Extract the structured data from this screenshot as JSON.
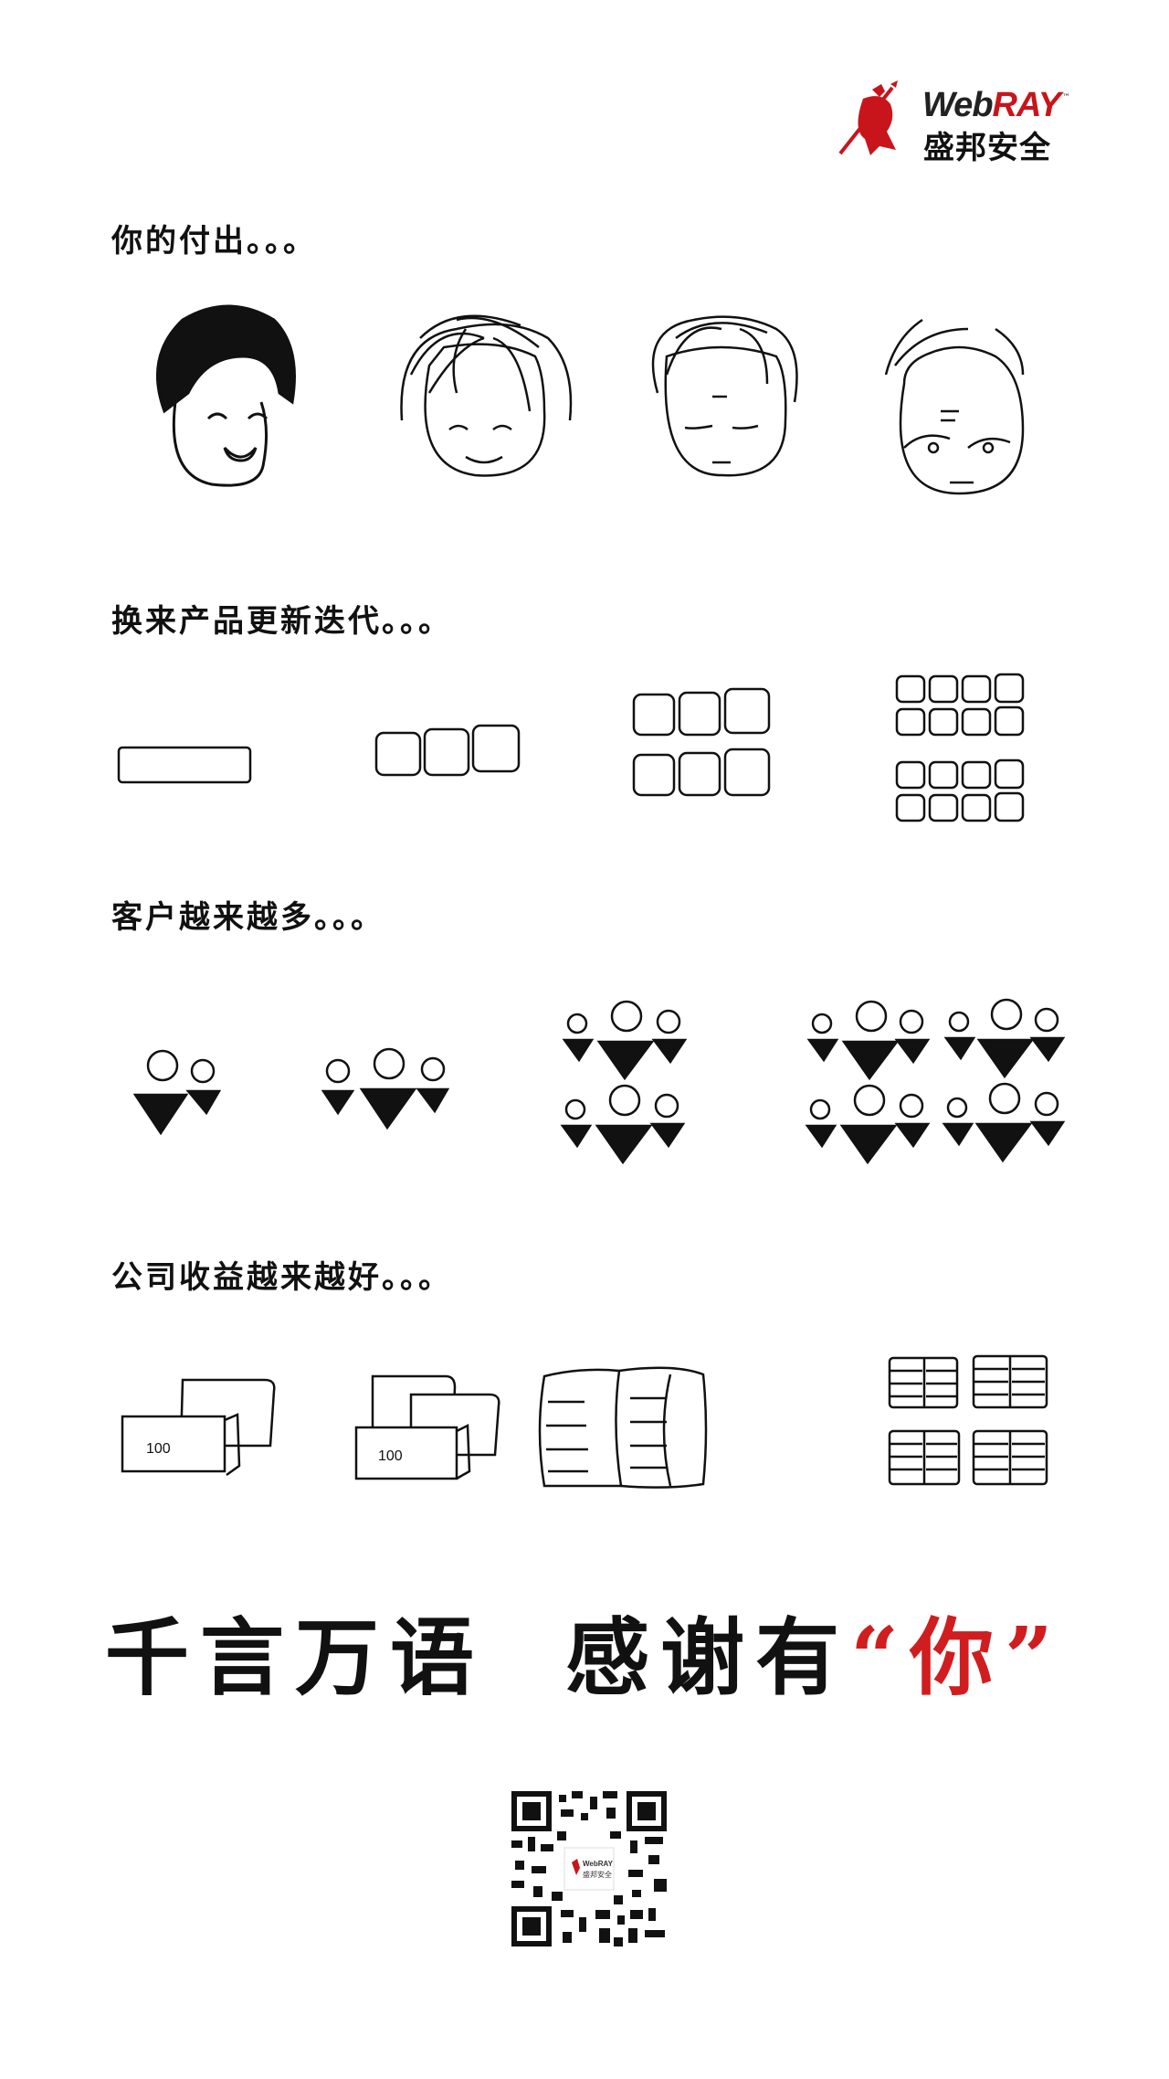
{
  "logo": {
    "web": "Web",
    "ray": "RAY",
    "tm": "™",
    "cn": "盛邦安全",
    "brand_red": "#c8151b"
  },
  "sections": [
    {
      "heading": "你的付出。。。"
    },
    {
      "heading": "换来产品更新迭代。。。"
    },
    {
      "heading": "客户越来越多。。。"
    },
    {
      "heading": "公司收益越来越好。。。"
    }
  ],
  "money_label": "100",
  "slogan": {
    "left": "千言万语  感谢有",
    "open_quote": "“",
    "highlight": "你",
    "close_quote": "”",
    "highlight_color": "#d01d1f"
  },
  "qr": {
    "icon": "qr-code-icon"
  }
}
